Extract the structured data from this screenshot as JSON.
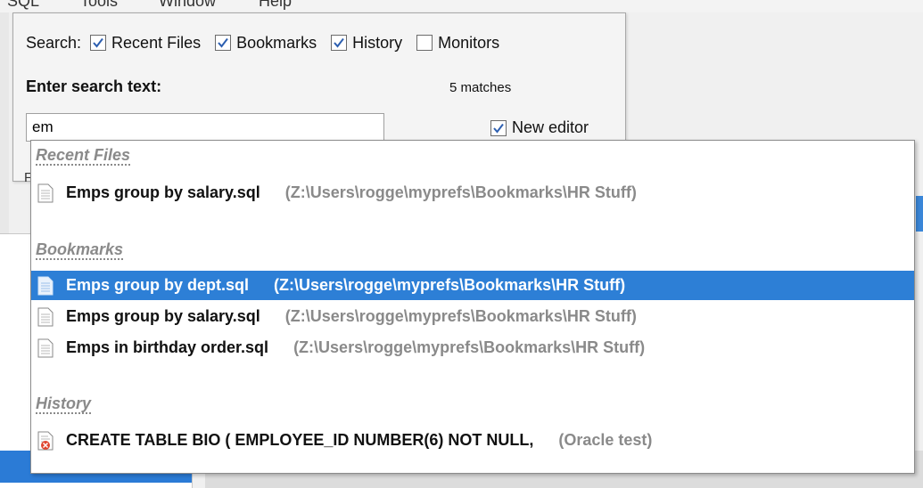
{
  "menubar": {
    "items": [
      "SQL",
      "Tools",
      "Window",
      "Help"
    ]
  },
  "search": {
    "label": "Search:",
    "options": [
      {
        "label": "Recent Files",
        "checked": true
      },
      {
        "label": "Bookmarks",
        "checked": true
      },
      {
        "label": "History",
        "checked": true
      },
      {
        "label": "Monitors",
        "checked": false
      }
    ],
    "enter_label": "Enter search text:",
    "matches": "5 matches",
    "input_value": "em",
    "new_editor_label": "New editor",
    "new_editor_checked": true,
    "partial_label": "F"
  },
  "results": {
    "recent_files_header": "Recent Files",
    "recent_files": [
      {
        "name": "Emps group by salary.sql",
        "path": "(Z:\\Users\\rogge\\myprefs\\Bookmarks\\HR Stuff)"
      }
    ],
    "bookmarks_header": "Bookmarks",
    "bookmarks": [
      {
        "name": "Emps group by dept.sql",
        "path": "(Z:\\Users\\rogge\\myprefs\\Bookmarks\\HR Stuff)",
        "selected": true
      },
      {
        "name": "Emps group by salary.sql",
        "path": "(Z:\\Users\\rogge\\myprefs\\Bookmarks\\HR Stuff)"
      },
      {
        "name": "Emps in birthday order.sql",
        "path": "(Z:\\Users\\rogge\\myprefs\\Bookmarks\\HR Stuff)"
      }
    ],
    "history_header": "History",
    "history": [
      {
        "name": "CREATE TABLE BIO ( EMPLOYEE_ID NUMBER(6) NOT NULL,",
        "path": "(Oracle test)"
      }
    ]
  },
  "colors": {
    "selection": "#2d7fd6",
    "muted_text": "#8a8a8a",
    "error_badge": "#e0452f"
  }
}
